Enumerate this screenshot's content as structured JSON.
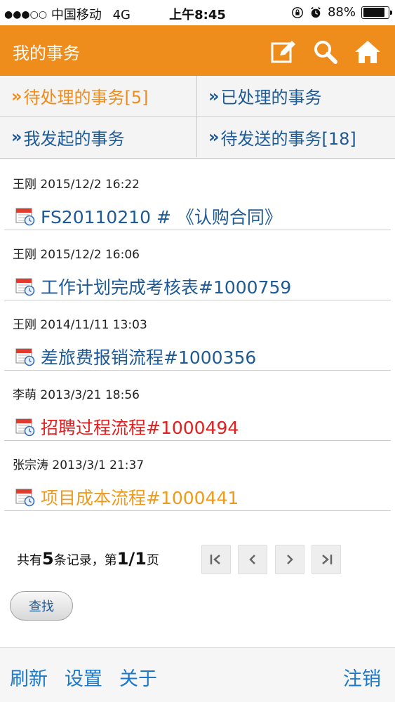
{
  "status_bar": {
    "signal_dots": "●●●○○",
    "carrier": "中国移动",
    "network": "4G",
    "time": "上午8:45",
    "battery_percent": "88%",
    "battery_level": 0.88,
    "icons": [
      "rotation-lock-icon",
      "alarm-icon",
      "battery-icon"
    ]
  },
  "header": {
    "title": "我的事务",
    "icons": [
      "edit-icon",
      "search-icon",
      "home-icon"
    ],
    "color": "#ee8c1c"
  },
  "tabs": [
    {
      "arrow": "»",
      "label": "待处理的事务[5]",
      "active": true
    },
    {
      "arrow": "»",
      "label": "已处理的事务",
      "active": false
    },
    {
      "arrow": "»",
      "label": "我发起的事务",
      "active": false
    },
    {
      "arrow": "»",
      "label": "待发送的事务[18]",
      "active": false
    }
  ],
  "items": [
    {
      "meta": "王刚 2015/12/2 16:22",
      "subject": "FS20110210 # 《认购合同》",
      "color": "#1e5a96"
    },
    {
      "meta": "王刚 2015/12/2 16:06",
      "subject": "工作计划完成考核表#1000759",
      "color": "#1e5a96"
    },
    {
      "meta": "王刚 2014/11/11 13:03",
      "subject": "差旅费报销流程#1000356",
      "color": "#1e5a96"
    },
    {
      "meta": "李萌 2013/3/21 18:56",
      "subject": "招聘过程流程#1000494",
      "color": "#e02020"
    },
    {
      "meta": "张宗涛 2013/3/1 21:37",
      "subject": "项目成本流程#1000441",
      "color": "#ee9a1c"
    }
  ],
  "pager": {
    "prefix": "共有",
    "count": "5",
    "mid": "条记录，第",
    "page": "1/1",
    "suffix": "页",
    "buttons": [
      {
        "name": "first-page-button",
        "glyph": "|‹"
      },
      {
        "name": "prev-page-button",
        "glyph": "‹"
      },
      {
        "name": "next-page-button",
        "glyph": "›"
      },
      {
        "name": "last-page-button",
        "glyph": "›|"
      }
    ]
  },
  "search_button": "查找",
  "footer": {
    "refresh": "刷新",
    "settings": "设置",
    "about": "关于",
    "logout": "注销"
  }
}
